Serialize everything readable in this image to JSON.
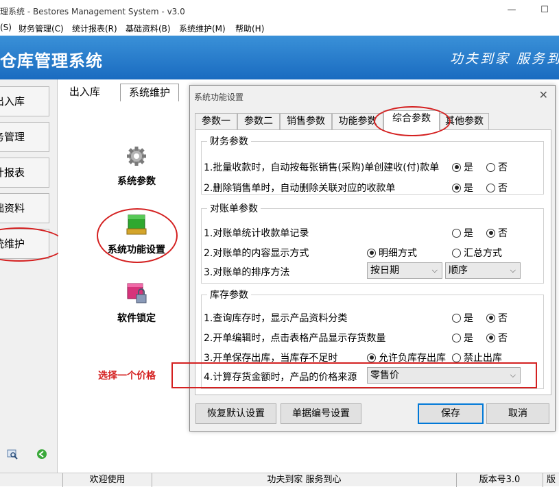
{
  "window": {
    "title": "理系统 - Bestores Management System - v3.0",
    "minimize": "—",
    "maximize": "☐"
  },
  "menu": [
    "(S)",
    "财务管理(C)",
    "统计报表(R)",
    "基础资料(B)",
    "系统维护(M)",
    "帮助(H)"
  ],
  "banner": {
    "title": "仓库管理系统",
    "slogan": "功夫到家 服务到"
  },
  "sidebar": {
    "items": [
      "出入库",
      "务管理",
      "计报表",
      "础资料",
      "统维护"
    ]
  },
  "content": {
    "tabs": [
      "出入库",
      "系统维护"
    ],
    "nav": [
      "系统参数",
      "系统功能设置",
      "软件锁定"
    ],
    "annotation_text": "选择一个价格"
  },
  "dialog": {
    "title": "系统功能设置",
    "close": "✕",
    "tabs": [
      "参数一",
      "参数二",
      "销售参数",
      "功能参数",
      "综合参数",
      "其他参数"
    ],
    "active_tab": "综合参数",
    "groups": {
      "finance": {
        "label": "财务参数",
        "rows": [
          {
            "text": "1.批量收款时，自动按每张销售(采购)单创建收(付)款单",
            "opt1": "是",
            "opt2": "否",
            "selected": "是"
          },
          {
            "text": "2.删除销售单时，自动删除关联对应的收款单",
            "opt1": "是",
            "opt2": "否",
            "selected": "是"
          }
        ]
      },
      "statement": {
        "label": "对账单参数",
        "row1": {
          "text": "1.对账单统计收款单记录",
          "opt1": "是",
          "opt2": "否",
          "selected": "否"
        },
        "row2": {
          "text": "2.对账单的内容显示方式",
          "opt1": "明细方式",
          "opt2": "汇总方式",
          "selected": "明细方式"
        },
        "row3": {
          "text": "3.对账单的排序方法",
          "combo1": "按日期",
          "combo2": "顺序"
        }
      },
      "stock": {
        "label": "库存参数",
        "row1": {
          "text": "1.查询库存时，显示产品资料分类",
          "opt1": "是",
          "opt2": "否",
          "selected": "否"
        },
        "row2": {
          "text": "2.开单编辑时，点击表格产品显示存货数量",
          "opt1": "是",
          "opt2": "否",
          "selected": "否"
        },
        "row3": {
          "text": "3.开单保存出库，当库存不足时",
          "opt1": "允许负库存出库",
          "opt2": "禁止出库",
          "selected": "允许负库存出库"
        },
        "row4": {
          "text": "4.计算存货金额时，产品的价格来源",
          "combo": "零售价"
        }
      }
    },
    "buttons": {
      "restore": "恢复默认设置",
      "numbering": "单据编号设置",
      "save": "保存",
      "cancel": "取消"
    }
  },
  "status": {
    "welcome": "欢迎使用",
    "slogan": "功夫到家 服务到心",
    "version": "版本号3.0",
    "extra": "版"
  }
}
